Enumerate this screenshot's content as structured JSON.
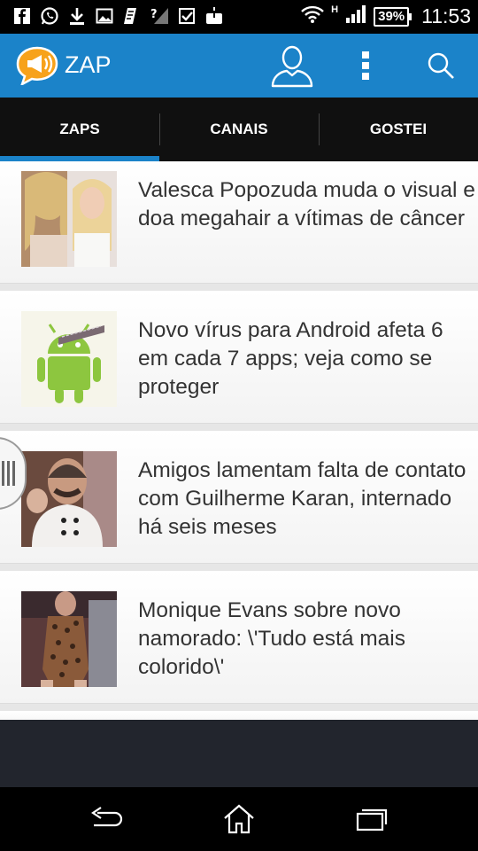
{
  "status_bar": {
    "icons_left": [
      "facebook-icon",
      "whatsapp-icon",
      "download-icon",
      "image-icon",
      "app-notification-icon",
      "signal-unknown-icon",
      "checkbox-icon",
      "upload-icon"
    ],
    "network_type": "H",
    "battery": "39%",
    "time": "11:53"
  },
  "app_bar": {
    "title": "ZAP",
    "accent_color": "#1b83c9"
  },
  "tabs": [
    {
      "label": "ZAPS",
      "active": true
    },
    {
      "label": "CANAIS",
      "active": false
    },
    {
      "label": "GOSTEI",
      "active": false
    }
  ],
  "feed": {
    "items": [
      {
        "headline": "Valesca Popozuda muda o visual e doa megahair a vítimas de câncer"
      },
      {
        "headline": "Novo vírus para Android afeta 6 em cada 7 apps; veja como se proteger"
      },
      {
        "headline": "Amigos lamentam falta de contato com Guilherme Karan, internado há seis meses"
      },
      {
        "headline": "Monique Evans sobre novo namorado: \\'Tudo está mais colorido\\'"
      }
    ]
  }
}
